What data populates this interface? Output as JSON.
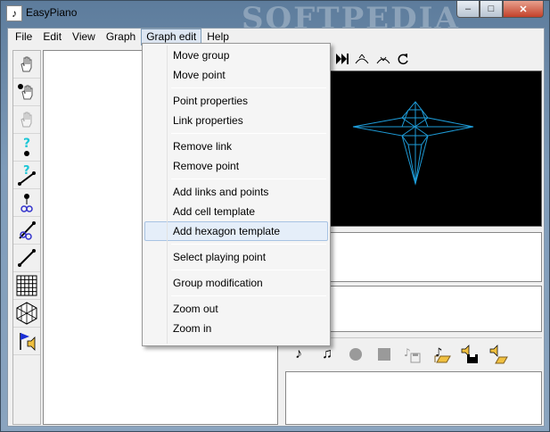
{
  "window": {
    "title": "EasyPiano",
    "watermark": "SOFTPEDIA",
    "app_icon": "piano-icon",
    "controls": {
      "minimize": "–",
      "maximize": "□",
      "close": "✕"
    }
  },
  "menubar": {
    "items": [
      {
        "label": "File"
      },
      {
        "label": "Edit"
      },
      {
        "label": "View"
      },
      {
        "label": "Graph"
      },
      {
        "label": "Graph edit"
      },
      {
        "label": "Help"
      }
    ],
    "active": "Graph edit"
  },
  "dropdown": {
    "groups": [
      [
        "Move group",
        "Move point"
      ],
      [
        "Point properties",
        "Link properties"
      ],
      [
        "Remove link",
        "Remove point"
      ],
      [
        "Add links and points",
        "Add cell template",
        "Add hexagon template"
      ],
      [
        "Select playing point"
      ],
      [
        "Group modification"
      ],
      [
        "Zoom out",
        "Zoom in"
      ]
    ],
    "highlighted": "Add hexagon template"
  },
  "left_toolbar": {
    "tools": [
      "hand-icon",
      "hand-point-icon",
      "hand-disabled-icon",
      "point-question-icon",
      "link-question-icon",
      "point-cut-icon",
      "link-cut-icon",
      "line-icon",
      "grid-icon",
      "hexagon-grid-icon",
      "flag-speaker-icon"
    ]
  },
  "right_toolbar": {
    "tools": [
      "play-icon",
      "up-arc-icon",
      "down-arc-icon",
      "rotate-icon"
    ]
  },
  "bottom_toolbar": {
    "tools": [
      "note-icon",
      "notes-icon",
      "record-icon",
      "stop-icon",
      "save-disabled-icon",
      "open-music-icon",
      "speaker-save-icon",
      "speaker-open-icon"
    ]
  },
  "colors": {
    "preview_bg": "#000000",
    "shape_stroke": "#1e9bd7",
    "menu_highlight": "#e5eef9"
  }
}
